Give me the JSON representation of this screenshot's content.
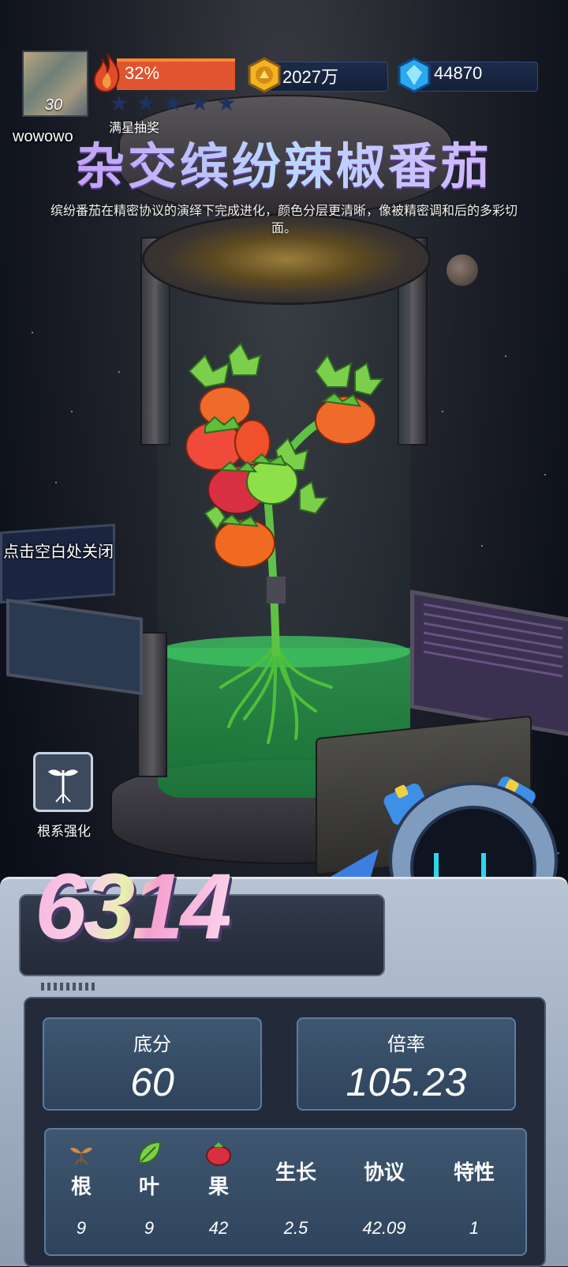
{
  "player": {
    "level": "30",
    "username": "wowowo",
    "energy_percent_label": "32%",
    "energy_fraction": 0.32,
    "stars_filled": 0,
    "stars_total": 5,
    "lottery_label": "满星抽奖"
  },
  "resources": {
    "coins": "2027万",
    "gems": "44870"
  },
  "item": {
    "name": "杂交缤纷辣椒番茄",
    "description": "缤纷番茄在精密协议的演绎下完成进化，颜色分层更清晰，像被精密调和后的多彩切面。"
  },
  "hints": {
    "close": "点击空白处关闭",
    "root_strengthen": "根系强化"
  },
  "score": {
    "total": "6314",
    "base_label": "底分",
    "base_value": "60",
    "multiplier_label": "倍率",
    "multiplier_value": "105.23"
  },
  "attributes": [
    {
      "name": "根",
      "value": "9",
      "icon": "sprout-root-icon"
    },
    {
      "name": "叶",
      "value": "9",
      "icon": "leaf-icon"
    },
    {
      "name": "果",
      "value": "42",
      "icon": "tomato-icon"
    },
    {
      "name": "生长",
      "value": "2.5"
    },
    {
      "name": "协议",
      "value": "42.09"
    },
    {
      "name": "特性",
      "value": "1"
    }
  ],
  "colors": {
    "energy_bar": "#e0552f",
    "title_gradient_start": "#c88cf0",
    "score_pink": "#f6a8d8",
    "panel_blue": "#3e5670"
  }
}
